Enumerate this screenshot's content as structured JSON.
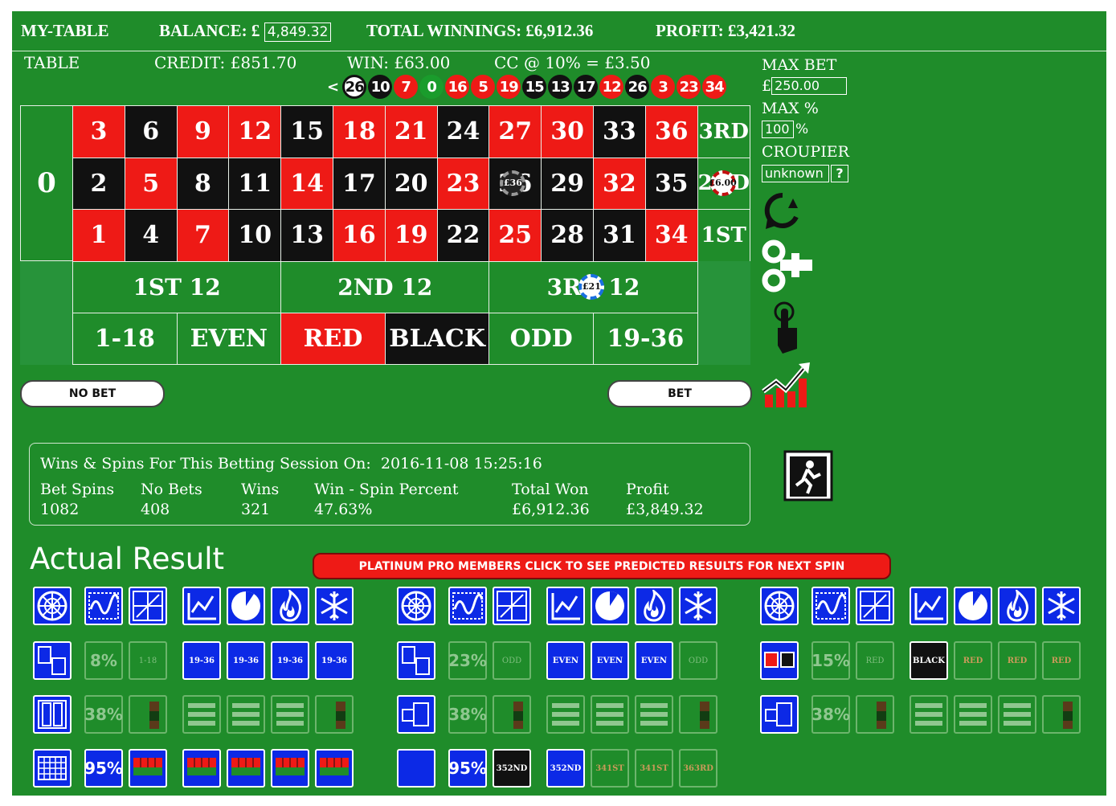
{
  "header": {
    "table_name": "MY-TABLE",
    "balance_label": "BALANCE: £",
    "balance_value": "4,849.32",
    "total_winnings": "TOTAL WINNINGS: £6,912.36",
    "profit": "PROFIT: £3,421.32"
  },
  "subheader": {
    "table": "TABLE",
    "credit": "CREDIT: £851.70",
    "win": "WIN: £63.00",
    "cc": "CC @ 10% = £3.50"
  },
  "history": {
    "arrow": "<",
    "spins": [
      {
        "n": "26",
        "c": "first"
      },
      {
        "n": "10",
        "c": "black"
      },
      {
        "n": "7",
        "c": "red"
      },
      {
        "n": "0",
        "c": "green"
      },
      {
        "n": "16",
        "c": "red"
      },
      {
        "n": "5",
        "c": "red"
      },
      {
        "n": "19",
        "c": "red"
      },
      {
        "n": "15",
        "c": "black"
      },
      {
        "n": "13",
        "c": "black"
      },
      {
        "n": "17",
        "c": "black"
      },
      {
        "n": "12",
        "c": "red"
      },
      {
        "n": "26",
        "c": "black"
      },
      {
        "n": "3",
        "c": "red"
      },
      {
        "n": "23",
        "c": "red"
      },
      {
        "n": "34",
        "c": "red"
      }
    ]
  },
  "sidebar": {
    "max_bet_label": "MAX BET",
    "currency": "£",
    "max_bet_value": "250.00",
    "max_pct_label": "MAX %",
    "max_pct_value": "100",
    "pct_sign": "%",
    "croupier_label": "CROUPIER",
    "croupier_value": "unknown",
    "help": "?",
    "icons": [
      "refresh-icon",
      "wind-up-key-icon",
      "pointing-hand-icon",
      "rising-chart-icon",
      "exit-icon"
    ]
  },
  "table": {
    "zero": "0",
    "rows": [
      [
        {
          "n": "3",
          "c": "red"
        },
        {
          "n": "6",
          "c": "black"
        },
        {
          "n": "9",
          "c": "red"
        },
        {
          "n": "12",
          "c": "red"
        },
        {
          "n": "15",
          "c": "black"
        },
        {
          "n": "18",
          "c": "red"
        },
        {
          "n": "21",
          "c": "red"
        },
        {
          "n": "24",
          "c": "black"
        },
        {
          "n": "27",
          "c": "red"
        },
        {
          "n": "30",
          "c": "red"
        },
        {
          "n": "33",
          "c": "black"
        },
        {
          "n": "36",
          "c": "red"
        }
      ],
      [
        {
          "n": "2",
          "c": "black"
        },
        {
          "n": "5",
          "c": "red"
        },
        {
          "n": "8",
          "c": "black"
        },
        {
          "n": "11",
          "c": "black"
        },
        {
          "n": "14",
          "c": "red"
        },
        {
          "n": "17",
          "c": "black"
        },
        {
          "n": "20",
          "c": "black"
        },
        {
          "n": "23",
          "c": "red"
        },
        {
          "n": "26",
          "c": "black"
        },
        {
          "n": "29",
          "c": "black"
        },
        {
          "n": "32",
          "c": "red"
        },
        {
          "n": "35",
          "c": "black"
        }
      ],
      [
        {
          "n": "1",
          "c": "red"
        },
        {
          "n": "4",
          "c": "black"
        },
        {
          "n": "7",
          "c": "red"
        },
        {
          "n": "10",
          "c": "black"
        },
        {
          "n": "13",
          "c": "black"
        },
        {
          "n": "16",
          "c": "red"
        },
        {
          "n": "19",
          "c": "red"
        },
        {
          "n": "22",
          "c": "black"
        },
        {
          "n": "25",
          "c": "red"
        },
        {
          "n": "28",
          "c": "black"
        },
        {
          "n": "31",
          "c": "black"
        },
        {
          "n": "34",
          "c": "red"
        }
      ]
    ],
    "columns": [
      "3RD",
      "2ND",
      "1ST"
    ],
    "dozens": [
      "1ST 12",
      "2ND 12",
      "3RD 12"
    ],
    "outside": [
      {
        "label": "1-18",
        "c": "green"
      },
      {
        "label": "EVEN",
        "c": "green"
      },
      {
        "label": "RED",
        "c": "red"
      },
      {
        "label": "BLACK",
        "c": "black"
      },
      {
        "label": "ODD",
        "c": "green"
      },
      {
        "label": "19-36",
        "c": "green"
      }
    ],
    "chips": [
      {
        "label": "£36",
        "on": "number-26"
      },
      {
        "label": "£6.00",
        "on": "column-2nd"
      },
      {
        "label": "£21",
        "on": "dozen-3rd"
      }
    ]
  },
  "buttons": {
    "no_bet": "NO BET",
    "bet": "BET"
  },
  "session": {
    "title": "Wins & Spins For This Betting Session On:",
    "date": "2016-11-08 15:25:16",
    "columns": [
      {
        "h": "Bet Spins",
        "v": "1082"
      },
      {
        "h": "No Bets",
        "v": "408"
      },
      {
        "h": "Wins",
        "v": "321"
      },
      {
        "h": "Win - Spin Percent",
        "v": "47.63%"
      },
      {
        "h": "Total Won",
        "v": "£6,912.36"
      },
      {
        "h": "Profit",
        "v": "£3,849.32"
      }
    ]
  },
  "results": {
    "title": "Actual Result",
    "pro_banner": "PLATINUM PRO MEMBERS CLICK TO SEE PREDICTED RESULTS FOR NEXT SPIN",
    "groups": [
      {
        "row2": {
          "pct": "8%",
          "ghost": "1-18",
          "vals": [
            "19-36",
            "19-36",
            "19-36",
            "19-36"
          ]
        },
        "row3": {
          "pct": "38%"
        },
        "row4": {
          "pct": "95%"
        }
      },
      {
        "row2": {
          "pct": "23%",
          "ghost": "ODD",
          "vals": [
            "EVEN",
            "EVEN",
            "EVEN"
          ],
          "ghost2": "ODD"
        },
        "row3": {
          "pct": "38%"
        },
        "row4": {
          "pct": "95%",
          "mini1": "35",
          "mini1b": "2ND",
          "mini2": "35",
          "mini2b": "2ND",
          "ghostmini": [
            [
              "34",
              "1ST"
            ],
            [
              "34",
              "1ST"
            ],
            [
              "36",
              "3RD"
            ]
          ]
        }
      },
      {
        "row2": {
          "pct": "15%",
          "ghost": "RED",
          "vals": [
            "BLACK"
          ],
          "ghost_after": [
            "RED",
            "RED",
            "RED"
          ]
        },
        "row3": {
          "pct": "38%"
        }
      }
    ]
  }
}
